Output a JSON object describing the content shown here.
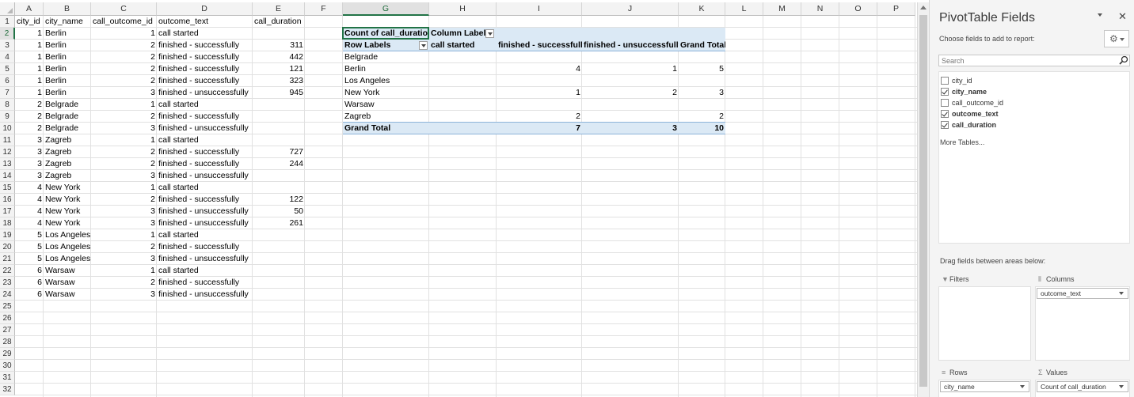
{
  "sheet": {
    "columns": [
      "A",
      "B",
      "C",
      "D",
      "E",
      "F",
      "G",
      "H",
      "I",
      "J",
      "K",
      "L",
      "M",
      "N",
      "O",
      "P"
    ],
    "rows": [
      1,
      2,
      3,
      4,
      5,
      6,
      7,
      8,
      9,
      10,
      11,
      12,
      13,
      14,
      15,
      16,
      17,
      18,
      19,
      20,
      21,
      22,
      23,
      24,
      25,
      26,
      27,
      28,
      29,
      30,
      31,
      32
    ],
    "headers": [
      "city_id",
      "city_name",
      "call_outcome_id",
      "outcome_text",
      "call_duration"
    ],
    "data": [
      [
        1,
        "Berlin",
        1,
        "call started",
        ""
      ],
      [
        1,
        "Berlin",
        2,
        "finished - successfully",
        311
      ],
      [
        1,
        "Berlin",
        2,
        "finished - successfully",
        442
      ],
      [
        1,
        "Berlin",
        2,
        "finished - successfully",
        121
      ],
      [
        1,
        "Berlin",
        2,
        "finished - successfully",
        323
      ],
      [
        1,
        "Berlin",
        3,
        "finished - unsuccessfully",
        945
      ],
      [
        2,
        "Belgrade",
        1,
        "call started",
        ""
      ],
      [
        2,
        "Belgrade",
        2,
        "finished - successfully",
        ""
      ],
      [
        2,
        "Belgrade",
        3,
        "finished - unsuccessfully",
        ""
      ],
      [
        3,
        "Zagreb",
        1,
        "call started",
        ""
      ],
      [
        3,
        "Zagreb",
        2,
        "finished - successfully",
        727
      ],
      [
        3,
        "Zagreb",
        2,
        "finished - successfully",
        244
      ],
      [
        3,
        "Zagreb",
        3,
        "finished - unsuccessfully",
        ""
      ],
      [
        4,
        "New York",
        1,
        "call started",
        ""
      ],
      [
        4,
        "New York",
        2,
        "finished - successfully",
        122
      ],
      [
        4,
        "New York",
        3,
        "finished - unsuccessfully",
        50
      ],
      [
        4,
        "New York",
        3,
        "finished - unsuccessfully",
        261
      ],
      [
        5,
        "Los Angeles",
        1,
        "call started",
        ""
      ],
      [
        5,
        "Los Angeles",
        2,
        "finished - successfully",
        ""
      ],
      [
        5,
        "Los Angeles",
        3,
        "finished - unsuccessfully",
        ""
      ],
      [
        6,
        "Warsaw",
        1,
        "call started",
        ""
      ],
      [
        6,
        "Warsaw",
        2,
        "finished - successfully",
        ""
      ],
      [
        6,
        "Warsaw",
        3,
        "finished - unsuccessfully",
        ""
      ]
    ]
  },
  "pivot": {
    "value_label": "Count of call_duration",
    "column_labels": "Column Labels",
    "row_labels": "Row Labels",
    "col_headers": [
      "call started",
      "finished - successfully",
      "finished - unsuccessfully",
      "Grand Total"
    ],
    "rows": [
      {
        "label": "Belgrade",
        "vals": [
          "",
          "",
          "",
          ""
        ]
      },
      {
        "label": "Berlin",
        "vals": [
          "",
          "4",
          "1",
          "5"
        ]
      },
      {
        "label": "Los Angeles",
        "vals": [
          "",
          "",
          "",
          ""
        ]
      },
      {
        "label": "New York",
        "vals": [
          "",
          "1",
          "2",
          "3"
        ]
      },
      {
        "label": "Warsaw",
        "vals": [
          "",
          "",
          "",
          ""
        ]
      },
      {
        "label": "Zagreb",
        "vals": [
          "",
          "2",
          "",
          "2"
        ]
      }
    ],
    "total": {
      "label": "Grand Total",
      "vals": [
        "",
        "7",
        "3",
        "10"
      ]
    }
  },
  "pane": {
    "title": "PivotTable Fields",
    "choose_label": "Choose fields to add to report:",
    "search_placeholder": "Search",
    "fields": [
      {
        "name": "city_id",
        "checked": false
      },
      {
        "name": "city_name",
        "checked": true
      },
      {
        "name": "call_outcome_id",
        "checked": false
      },
      {
        "name": "outcome_text",
        "checked": true
      },
      {
        "name": "call_duration",
        "checked": true
      }
    ],
    "more_tables": "More Tables...",
    "drag_hint": "Drag fields between areas below:",
    "areas": {
      "filters": "Filters",
      "columns": "Columns",
      "rows": "Rows",
      "values": "Values",
      "columns_field": "outcome_text",
      "rows_field": "city_name",
      "values_field": "Count of call_duration"
    }
  }
}
